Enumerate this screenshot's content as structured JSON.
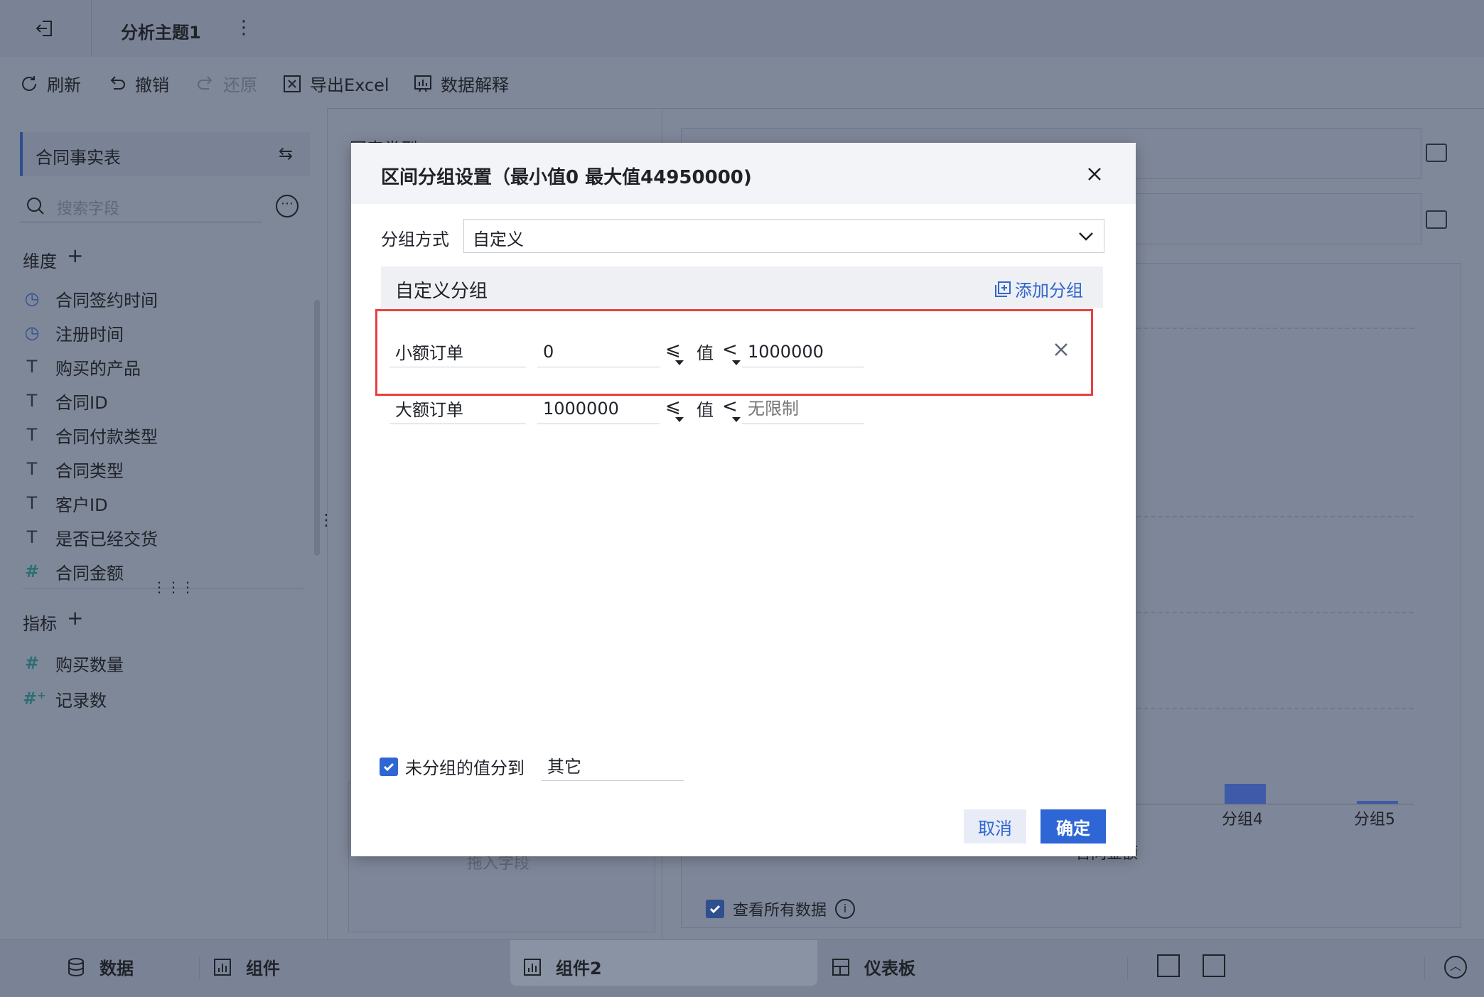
{
  "header": {
    "title": "分析主题1"
  },
  "toolbar": {
    "refresh": "刷新",
    "undo": "撤销",
    "redo": "还原",
    "export": "导出Excel",
    "explain": "数据解释"
  },
  "left": {
    "dataset": "合同事实表",
    "search_placeholder": "搜索字段",
    "dimension_label": "维度",
    "dimensions": [
      {
        "icon": "clock-icon",
        "label": "合同签约时间"
      },
      {
        "icon": "clock-icon",
        "label": "注册时间"
      },
      {
        "icon": "text-icon",
        "label": "购买的产品"
      },
      {
        "icon": "text-icon",
        "label": "合同ID"
      },
      {
        "icon": "text-icon",
        "label": "合同付款类型"
      },
      {
        "icon": "text-icon",
        "label": "合同类型"
      },
      {
        "icon": "text-icon",
        "label": "客户ID"
      },
      {
        "icon": "text-icon",
        "label": "是否已经交货"
      },
      {
        "icon": "hash-icon",
        "label": "合同金额"
      }
    ],
    "measure_label": "指标",
    "measures": [
      {
        "icon": "hash-icon",
        "label": "购买数量"
      },
      {
        "icon": "hash-plus-icon",
        "label": "记录数"
      }
    ]
  },
  "background": {
    "chart_type_label": "图表类型",
    "drop_field": "拖入字段",
    "x_ticks": [
      "分组4",
      "分组5"
    ],
    "x_axis_label": "合同金额",
    "view_all": "查看所有数据"
  },
  "dialog": {
    "title": "区间分组设置（最小值0 最大值44950000)",
    "group_method_label": "分组方式",
    "group_method_value": "自定义",
    "custom_group_title": "自定义分组",
    "add_group": "添加分组",
    "value_label": "值",
    "op_le": "⩽",
    "op_lt": "<",
    "groups": [
      {
        "name": "小额订单",
        "min": "0",
        "max": "1000000",
        "max_placeholder": ""
      },
      {
        "name": "大额订单",
        "min": "1000000",
        "max": "",
        "max_placeholder": "无限制"
      }
    ],
    "ungrouped_label": "未分组的值分到",
    "ungrouped_value": "其它",
    "cancel": "取消",
    "ok": "确定"
  },
  "bottom": {
    "data_tab": "数据",
    "component_tab": "组件",
    "component2_tab": "组件2",
    "dashboard_tab": "仪表板"
  }
}
